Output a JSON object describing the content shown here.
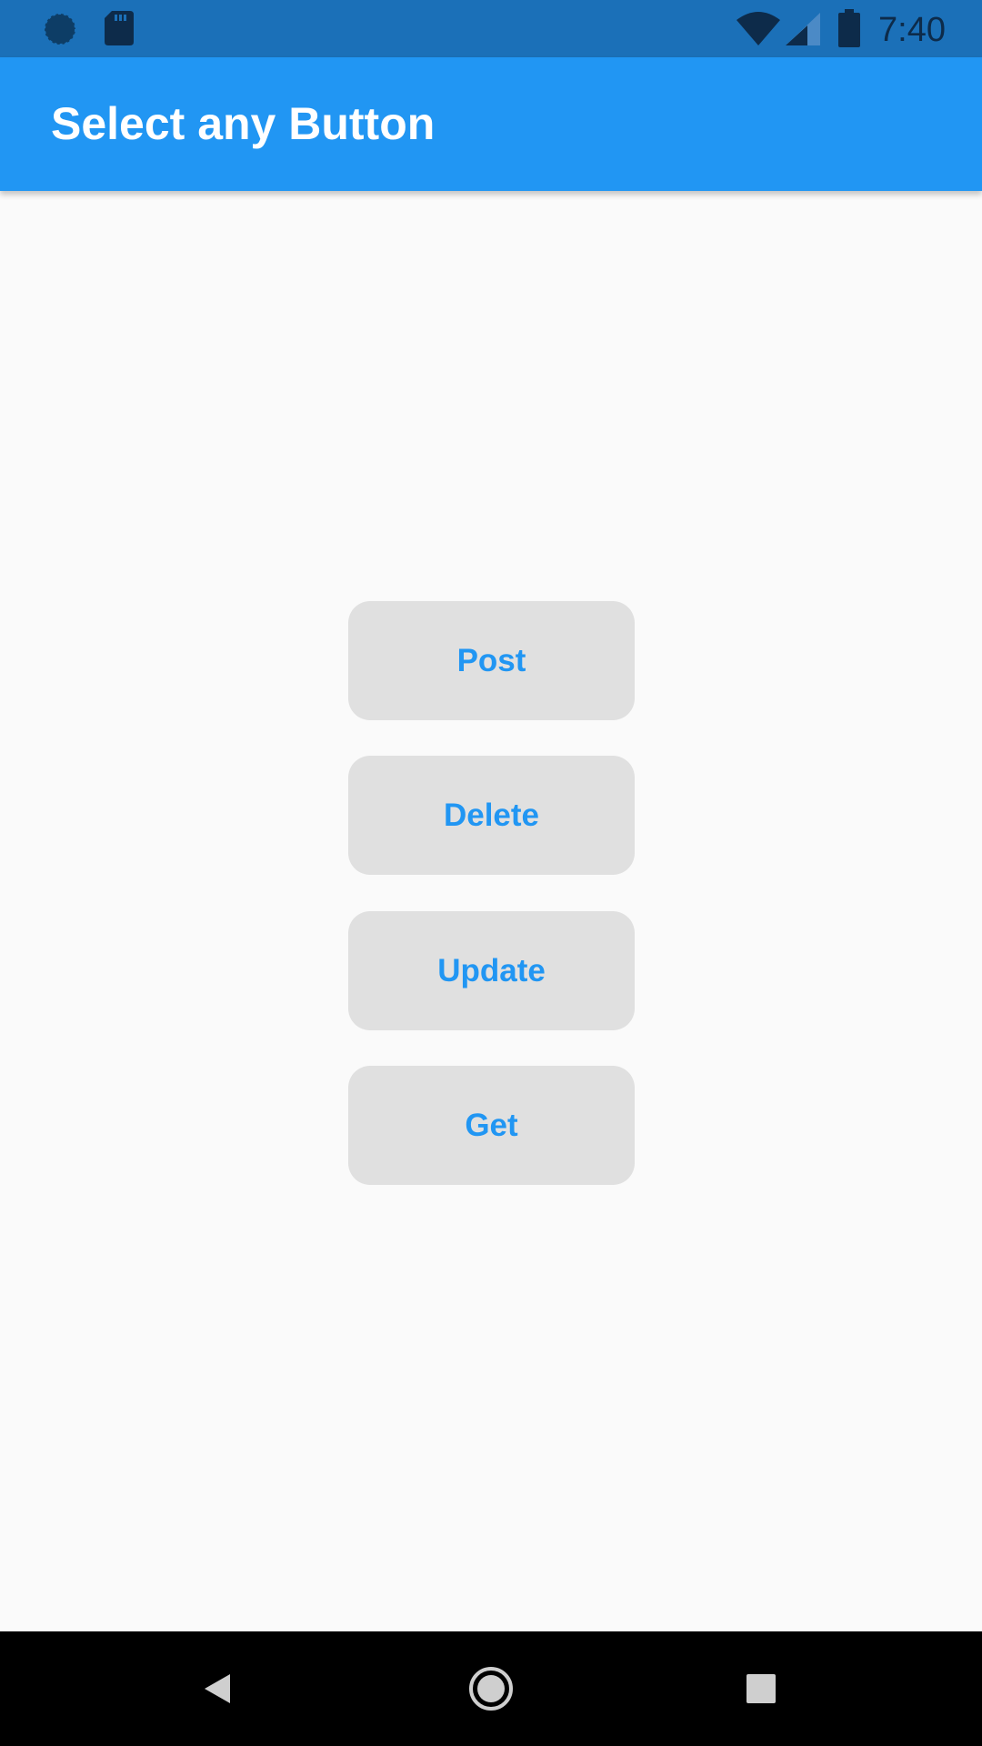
{
  "status_bar": {
    "time": "7:40",
    "icons": [
      "sync-icon",
      "sd-card-icon",
      "wifi-icon",
      "signal-icon",
      "battery-icon"
    ]
  },
  "app_bar": {
    "title": "Select any Button",
    "color": "#2196f3"
  },
  "buttons": [
    {
      "label": "Post"
    },
    {
      "label": "Delete"
    },
    {
      "label": "Update"
    },
    {
      "label": "Get"
    }
  ],
  "nav_bar": {
    "icons": [
      "back-icon",
      "home-icon",
      "recents-icon"
    ]
  },
  "colors": {
    "status_bar": "#1b70b8",
    "accent": "#2196f3",
    "button_bg": "#e0e0e0",
    "background": "#fafafa"
  }
}
